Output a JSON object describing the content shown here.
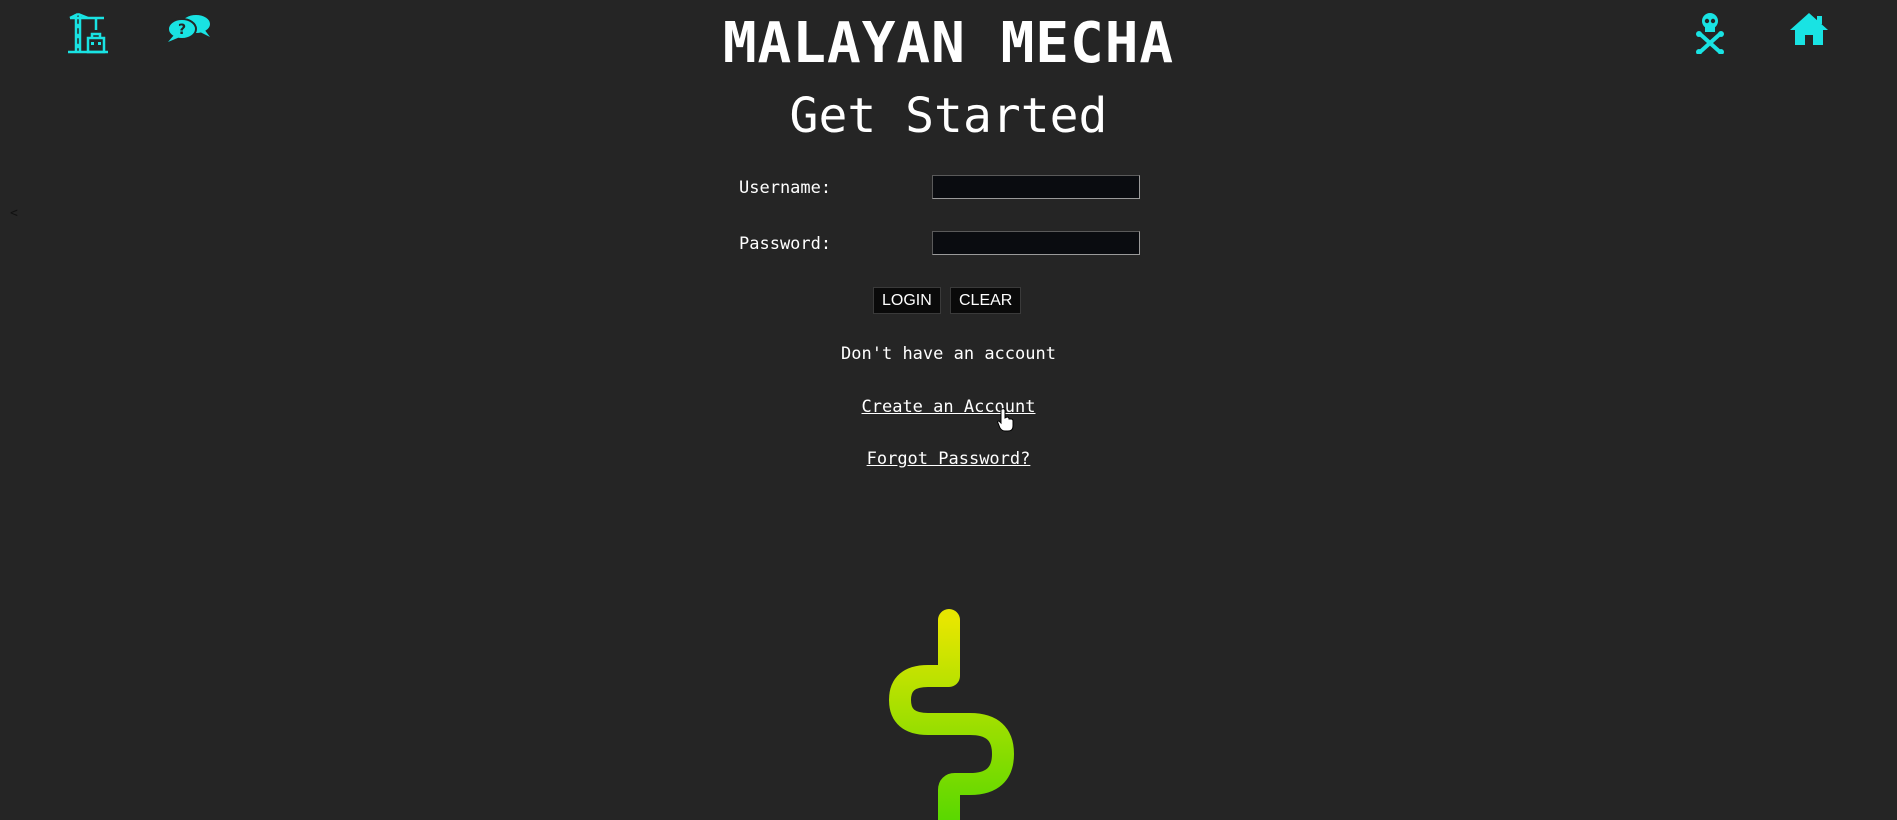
{
  "header": {
    "brand_title": "MALAYAN MECHA",
    "page_subtitle": "Get Started",
    "left_icons": [
      "construction-crane-icon",
      "help-chat-icon"
    ],
    "right_icons": [
      "skull-crossbones-icon",
      "home-icon"
    ]
  },
  "nav": {
    "back_glyph": "<"
  },
  "login_form": {
    "username_label": "Username:",
    "username_value": "",
    "password_label": "Password:",
    "password_value": "",
    "login_button": "LOGIN",
    "clear_button": "CLEAR"
  },
  "account": {
    "no_account_text": "Don't have an account",
    "create_account_link": "Create an Account",
    "forgot_password_link": "Forgot Password?"
  },
  "colors": {
    "background": "#252525",
    "icon_accent": "#19e3e3",
    "logo_gradient_top": "#e6e600",
    "logo_gradient_bottom": "#5ad800"
  }
}
